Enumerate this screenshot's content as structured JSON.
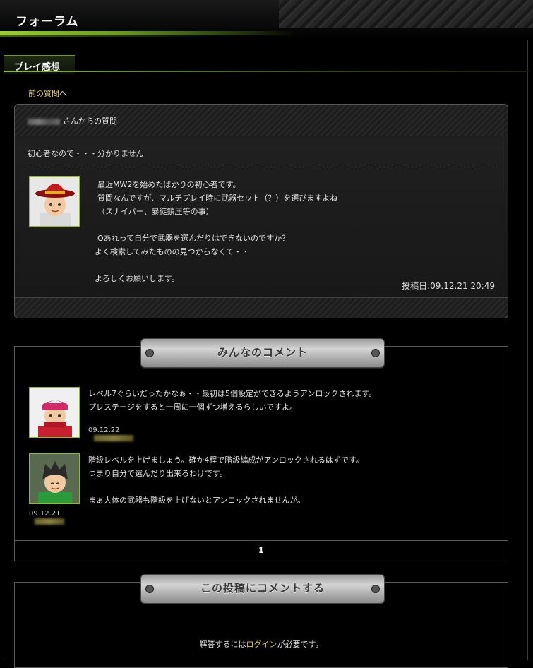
{
  "header": {
    "title": "フォーラム"
  },
  "section": {
    "title": "プレイ感想"
  },
  "nav": {
    "prev_link": "前の質問へ"
  },
  "question": {
    "author_suffix": "さんからの質問",
    "title": "初心者なので・・・分かりません",
    "body_lines": [
      "最近MW2を始めたばかりの初心者です。",
      "質問なんですが、マルチプレイ時に武器セット（？）を選びますよね",
      "（スナイパー、暴徒鎮圧等の事）",
      "",
      "Qあれって自分で武器を選んだりはできないのですか？",
      "よく検索してみたものの見つからなくて・・",
      "",
      "よろしくお願いします。"
    ],
    "posted_label": "投稿日:09.12.21 20:49"
  },
  "comments_section": {
    "title": "みんなのコメント",
    "comments": [
      {
        "lines": [
          "レベル7ぐらいだったかなぁ・・最初は5個設定ができるようアンロックされます。",
          "プレステージをすると一周に一個ずつ増えるらしいですよ。"
        ],
        "date": "09.12.22"
      },
      {
        "lines": [
          "階級レベルを上げましょう。確か4程で階級編成がアンロックされるはずです。",
          "つまり自分で選んだり出来るわけです。",
          "",
          "まぁ大体の武器も階級を上げないとアンロックされませんが。"
        ],
        "date": "09.12.21"
      }
    ],
    "pager": "1"
  },
  "comment_form": {
    "title": "この投稿にコメントする",
    "msg_before": "解答するには",
    "login_link": "ログイン",
    "msg_after": "が必要です。"
  },
  "colors": {
    "accent_green": "#8cc224",
    "link_gold": "#e7c04a"
  }
}
